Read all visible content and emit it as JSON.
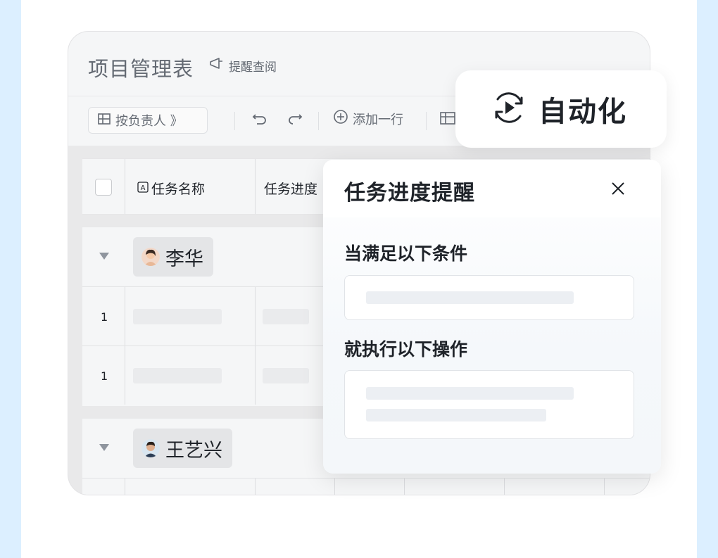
{
  "header": {
    "title": "项目管理表",
    "remind_label": "提醒查阅"
  },
  "toolbar": {
    "group_label": "按负责人 》",
    "add_row_label": "添加一行"
  },
  "table": {
    "columns": [
      "任务名称",
      "任务进度"
    ],
    "groups": [
      {
        "owner": "李华",
        "rows": [
          "1",
          "1"
        ]
      },
      {
        "owner": "王艺兴",
        "rows": []
      }
    ]
  },
  "automation": {
    "badge_label": "自动化"
  },
  "panel": {
    "title": "任务进度提醒",
    "condition_label": "当满足以下条件",
    "action_label": "就执行以下操作"
  },
  "colors": {
    "background": "#dcefff",
    "text": "#1f2329",
    "muted": "#646a73"
  }
}
